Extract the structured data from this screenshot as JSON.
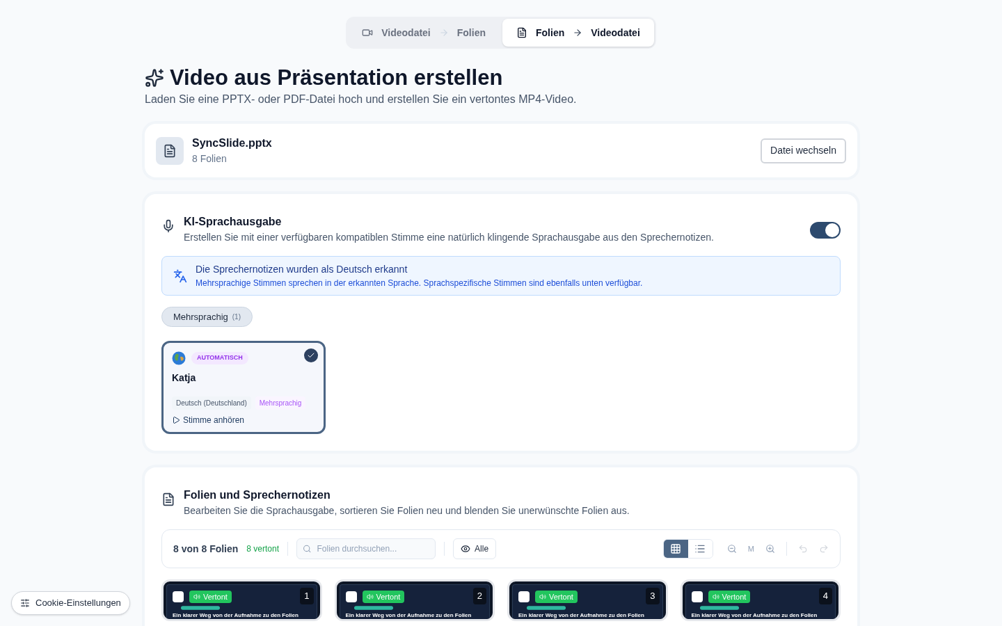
{
  "mode_switch": [
    {
      "kind": "video",
      "from": "Videodatei",
      "to": "Folien",
      "selected": false
    },
    {
      "kind": "document",
      "from": "Folien",
      "to": "Videodatei",
      "selected": true
    }
  ],
  "heading": {
    "title": "Video aus Präsentation erstellen",
    "subtitle": "Laden Sie eine PPTX- oder PDF-Datei hoch und erstellen Sie ein vertontes MP4-Video."
  },
  "file": {
    "name": "SyncSlide.pptx",
    "info": "8 Folien",
    "button": "Datei wechseln"
  },
  "voice_section": {
    "title": "KI-Sprachausgabe",
    "description": "Erstellen Sie mit einer verfügbaren kompatiblen Stimme eine natürlich klingende Sprachausgabe aus den Sprechernotizen.",
    "on": true,
    "notice": {
      "title": "Die Sprechernotizen wurden als Deutsch erkannt",
      "text": "Mehrsprachige Stimmen sprechen in der erkannten Sprache. Sprachspezifische Stimmen sind ebenfalls unten verfügbar."
    },
    "filters": [
      {
        "label": "Mehrsprachig",
        "count": "(1)",
        "selected": true
      }
    ],
    "voices": [
      {
        "badge": "AUTOMATISCH",
        "name": "Katja",
        "language": "Deutsch (Deutschland)",
        "tag": "Mehrsprachig",
        "preview": "Stimme anhören",
        "selected": true
      }
    ]
  },
  "slides_section": {
    "title": "Folien und Sprechernotizen",
    "description": "Bearbeiten Sie die Sprachausgabe, sortieren Sie Folien neu und blenden Sie unerwünschte Folien aus.",
    "toolbar": {
      "count": "8 von 8 Folien",
      "voiced": "8 vertont",
      "search_placeholder": "Folien durchsuchen...",
      "filter": "Alle",
      "views": [
        {
          "kind": "grid",
          "selected": true
        },
        {
          "kind": "list",
          "selected": false
        }
      ],
      "zoom_label": "M"
    },
    "slides": [
      {
        "number": "1",
        "status": "Vertont",
        "checked": false,
        "text": "Ein klarer Weg von der Aufnahme zu den Folien"
      },
      {
        "number": "2",
        "status": "Vertont",
        "checked": false,
        "text": "Ein klarer Weg von der Aufnahme zu den Folien"
      },
      {
        "number": "3",
        "status": "Vertont",
        "checked": false,
        "text": "Ein klarer Weg von der Aufnahme zu den Folien"
      },
      {
        "number": "4",
        "status": "Vertont",
        "checked": false,
        "text": "Ein klarer Weg von der Aufnahme zu den Folien"
      }
    ]
  },
  "cookie_button": "Cookie-Einstellungen"
}
